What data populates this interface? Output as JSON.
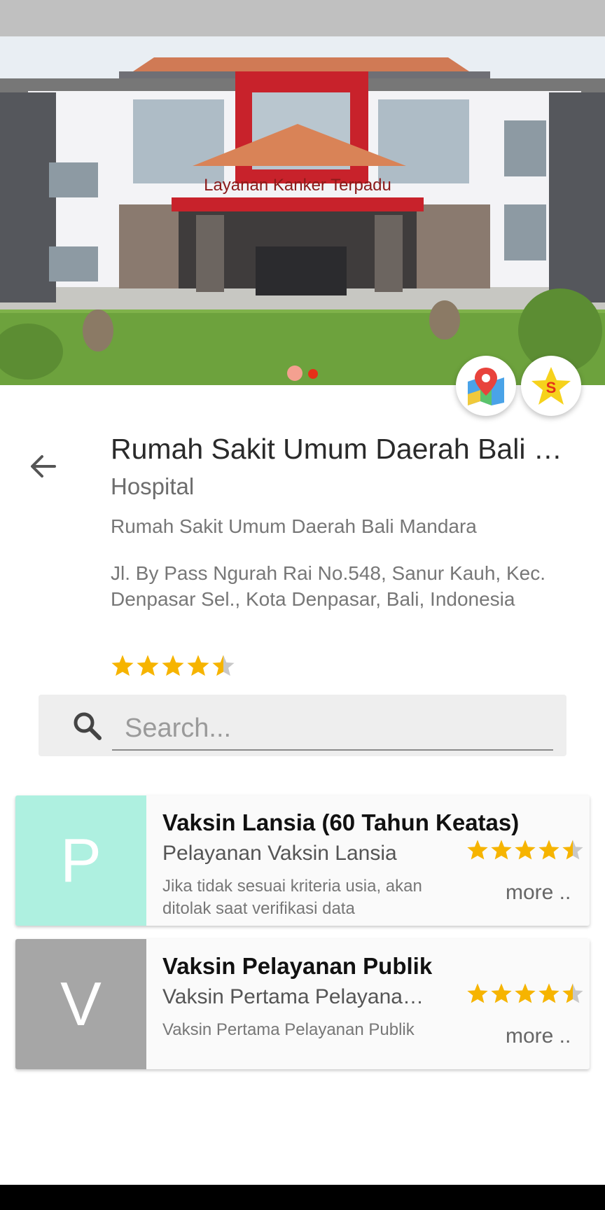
{
  "place": {
    "title": "Rumah Sakit Umum Daerah Bali Mandara",
    "category": "Hospital",
    "full_name": "Rumah Sakit Umum Daerah Bali Mandara",
    "address": "Jl. By Pass Ngurah Rai No.548, Sanur Kauh, Kec. Denpasar Sel., Kota Denpasar, Bali, Indonesia",
    "rating": 4.5
  },
  "hero": {
    "sign_text": "Layanan Kanker Terpadu",
    "slide_count": 2,
    "active_slide": 2
  },
  "fab": {
    "map_icon": "map-pin-icon",
    "star_icon": "star-badge-icon",
    "star_letter": "S"
  },
  "search": {
    "placeholder": "Search..."
  },
  "services": [
    {
      "initial": "P",
      "avatar_color": "#aef0e0",
      "title": "Vaksin Lansia (60 Tahun Keatas)",
      "subtitle": "Pelayanan Vaksin Lansia",
      "description": "Jika tidak sesuai kriteria usia, akan ditolak saat verifikasi data",
      "rating": 4.5,
      "more": "more .."
    },
    {
      "initial": "V",
      "avatar_color": "#a6a6a6",
      "title": "Vaksin Pelayanan Publik",
      "subtitle": "Vaksin Pertama Pelayanan Publik",
      "description": "Vaksin Pertama Pelayanan Publik",
      "rating": 4.5,
      "more": "more .."
    }
  ],
  "colors": {
    "star": "#f6b400",
    "star_empty": "#c8c8c8",
    "dot_active": "#e53018"
  }
}
